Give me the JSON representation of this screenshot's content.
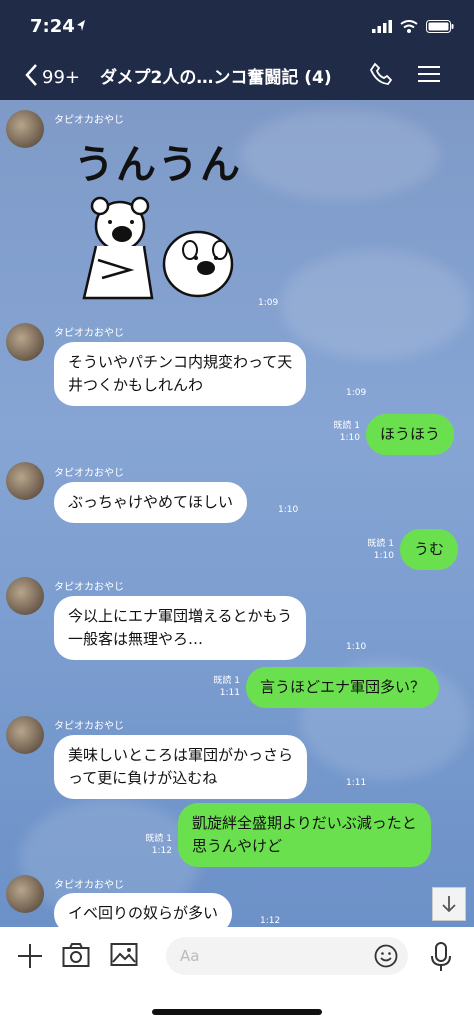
{
  "status": {
    "time": "7:24",
    "colors": {
      "bar": "#1f2b47"
    }
  },
  "header": {
    "back_count": "99+",
    "title": "ダメプ2人の…ンコ奮闘記 (4)"
  },
  "sticker": {
    "text": "うんうん"
  },
  "messages": [
    {
      "type": "sticker",
      "sender": "タピオカおやじ",
      "time": "1:09"
    },
    {
      "type": "in",
      "sender": "タピオカおやじ",
      "lines": [
        "そういやパチンコ内規変わって天",
        "井つくかもしれんわ"
      ],
      "time": "1:09"
    },
    {
      "type": "out",
      "text": "ほうほう",
      "read": "既読 1",
      "time": "1:10"
    },
    {
      "type": "in",
      "sender": "タピオカおやじ",
      "lines": [
        "ぶっちゃけやめてほしい"
      ],
      "time": "1:10"
    },
    {
      "type": "out",
      "text": "うむ",
      "read": "既読 1",
      "time": "1:10"
    },
    {
      "type": "in",
      "sender": "タピオカおやじ",
      "lines": [
        "今以上にエナ軍団増えるとかもう",
        "一般客は無理やろ…"
      ],
      "time": "1:10"
    },
    {
      "type": "out",
      "text": "言うほどエナ軍団多い？",
      "read": "既読 1",
      "time": "1:11"
    },
    {
      "type": "in",
      "sender": "タピオカおやじ",
      "lines": [
        "美味しいところは軍団がかっさら",
        "って更に負けが込むね"
      ],
      "time": "1:11"
    },
    {
      "type": "out",
      "lines": [
        "凱旋絆全盛期よりだいぶ減ったと",
        "思うんやけど"
      ],
      "read": "既読 1",
      "time": "1:12"
    },
    {
      "type": "in",
      "sender": "タピオカおやじ",
      "lines": [
        "イベ回りの奴らが多い"
      ],
      "time": "1:12"
    }
  ],
  "input": {
    "placeholder": "Aa"
  },
  "icons": [
    "back-chevron-icon",
    "phone-icon",
    "menu-icon",
    "plus-icon",
    "camera-icon",
    "image-icon",
    "emoji-icon",
    "microphone-icon",
    "arrow-down-icon"
  ]
}
